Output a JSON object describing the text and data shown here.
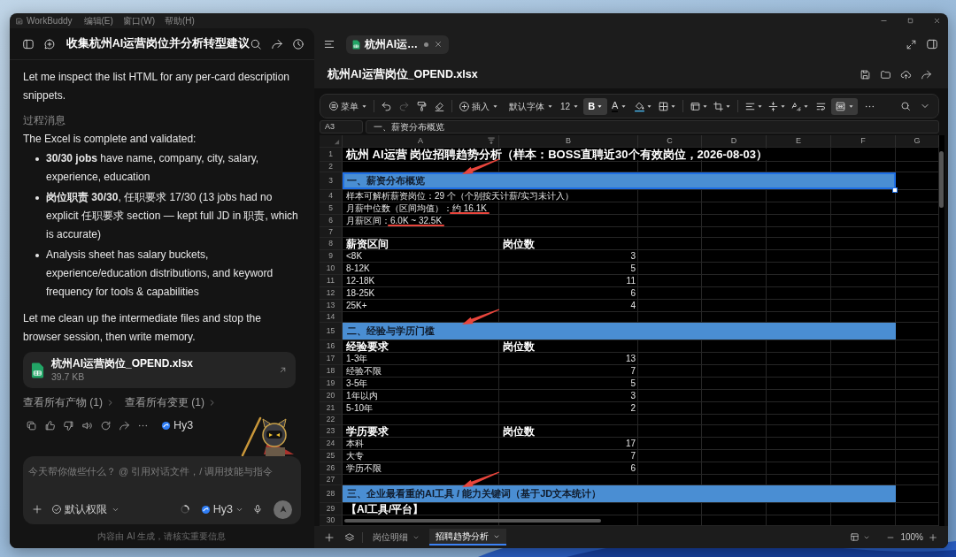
{
  "app": {
    "name": "WorkBuddy",
    "menus": [
      "编辑(E)",
      "窗口(W)",
      "帮助(H)"
    ]
  },
  "chat": {
    "title": "收集杭州AI运营岗位并分析转型建议",
    "messages": [
      {
        "kind": "paragraph",
        "text": "Let me inspect the list HTML for any per-card description snippets."
      },
      {
        "kind": "label",
        "text": "过程消息"
      },
      {
        "kind": "paragraph",
        "text": "The Excel is complete and validated:"
      },
      {
        "kind": "bullets",
        "items": [
          "**30/30 jobs** have name, company, city, salary, experience, education",
          "**岗位职责 30/30**, 任职要求 17/30 (13 jobs had no explicit 任职要求 section — kept full JD in 职责, which is accurate)",
          "Analysis sheet has salary buckets, experience/education distributions, and keyword frequency for tools & capabilities"
        ]
      },
      {
        "kind": "paragraph",
        "text": "Let me clean up the intermediate files and stop the browser session, then write memory."
      },
      {
        "kind": "file",
        "name": "杭州AI运营岗位_OPEND.xlsx",
        "size": "39.7 KB"
      }
    ],
    "links": [
      "查看所有产物 (1)",
      "查看所有变更 (1)"
    ],
    "reply_model": "Hy3",
    "composer": {
      "placeholder": "今天帮你做些什么？ @ 引用对话文件，/ 调用技能与指令",
      "permission": "默认权限",
      "model": "Hy3"
    },
    "footer": "内容由 AI 生成，请核实重要信息"
  },
  "editor": {
    "tabs": [
      {
        "label": "杭州AI运…",
        "selected": true,
        "unsaved": true
      }
    ],
    "file_title": "杭州AI运营岗位_OPEND.xlsx",
    "toolbar": {
      "menu": "菜单",
      "insert": "插入",
      "font": "默认字体",
      "font_size": "12",
      "bold": {
        "label": "B",
        "active": true
      },
      "font_color": "A",
      "redo": {
        "disabled": true
      },
      "merge_cells": {
        "active": true
      }
    },
    "formula_bar": {
      "cell": "A3",
      "content": "一、薪资分布概览"
    },
    "columns": [
      "A",
      "B",
      "C",
      "D",
      "E",
      "F",
      "G"
    ],
    "rows": [
      {
        "number": "1",
        "kind": "title",
        "text": "杭州 AI运营 岗位招聘趋势分析（样本：BOSS直聘近30个有效岗位，2026-08-03）"
      },
      {
        "number": "2",
        "kind": "blank"
      },
      {
        "number": "3",
        "kind": "section",
        "text": "一、薪资分布概览",
        "selected": true,
        "arrow_mark": true
      },
      {
        "number": "4",
        "kind": "text",
        "text": "样本可解析薪资岗位：29 个（个别按天计薪/实习未计入）"
      },
      {
        "number": "5",
        "kind": "stat",
        "label": "月薪中位数（区间均值）：",
        "value": "约 16.1K",
        "underlined": true
      },
      {
        "number": "6",
        "kind": "stat",
        "label": "月薪区间：",
        "value": "6.0K ~ 32.5K",
        "underlined": true
      },
      {
        "number": "7",
        "kind": "blank"
      },
      {
        "number": "8",
        "kind": "header",
        "cells": [
          "薪资区间",
          "岗位数"
        ]
      },
      {
        "number": "9",
        "kind": "data",
        "cells": [
          "<8K",
          "3"
        ]
      },
      {
        "number": "10",
        "kind": "data",
        "cells": [
          "8-12K",
          "5"
        ]
      },
      {
        "number": "11",
        "kind": "data",
        "cells": [
          "12-18K",
          "11"
        ]
      },
      {
        "number": "12",
        "kind": "data",
        "cells": [
          "18-25K",
          "6"
        ]
      },
      {
        "number": "13",
        "kind": "data",
        "cells": [
          "25K+",
          "4"
        ]
      },
      {
        "number": "14",
        "kind": "blank"
      },
      {
        "number": "15",
        "kind": "section",
        "text": "二、经验与学历门槛",
        "selected": false,
        "arrow_mark": true
      },
      {
        "number": "16",
        "kind": "header",
        "cells": [
          "经验要求",
          "岗位数"
        ]
      },
      {
        "number": "17",
        "kind": "data",
        "cells": [
          "1-3年",
          "13"
        ]
      },
      {
        "number": "18",
        "kind": "data",
        "cells": [
          "经验不限",
          "7"
        ]
      },
      {
        "number": "19",
        "kind": "data",
        "cells": [
          "3-5年",
          "5"
        ]
      },
      {
        "number": "20",
        "kind": "data",
        "cells": [
          "1年以内",
          "3"
        ]
      },
      {
        "number": "21",
        "kind": "data",
        "cells": [
          "5-10年",
          "2"
        ]
      },
      {
        "number": "22",
        "kind": "blank"
      },
      {
        "number": "23",
        "kind": "header",
        "cells": [
          "学历要求",
          "岗位数"
        ]
      },
      {
        "number": "24",
        "kind": "data",
        "cells": [
          "本科",
          "17"
        ]
      },
      {
        "number": "25",
        "kind": "data",
        "cells": [
          "大专",
          "7"
        ]
      },
      {
        "number": "26",
        "kind": "data",
        "cells": [
          "学历不限",
          "6"
        ]
      },
      {
        "number": "27",
        "kind": "blank"
      },
      {
        "number": "28",
        "kind": "section",
        "text": "三、企业最看重的AI工具 / 能力关键词（基于JD文本统计）",
        "selected": false,
        "arrow_mark": true
      },
      {
        "number": "29",
        "kind": "subheader",
        "text": "【AI工具/平台】"
      },
      {
        "number": "30",
        "kind": "blank"
      }
    ],
    "sheets": [
      {
        "label": "岗位明细",
        "selected": false
      },
      {
        "label": "招聘趋势分析",
        "selected": true
      }
    ],
    "zoom": "100%"
  }
}
